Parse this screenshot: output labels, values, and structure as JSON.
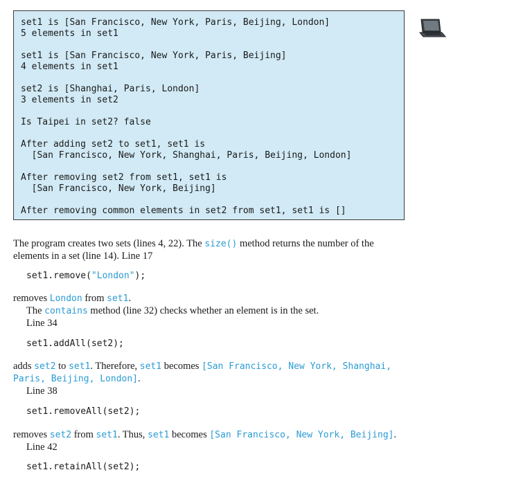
{
  "console": {
    "lines": [
      "set1 is [San Francisco, New York, Paris, Beijing, London]",
      "5 elements in set1",
      "set1 is [San Francisco, New York, Paris, Beijing]",
      "4 elements in set1",
      "set2 is [Shanghai, Paris, London]",
      "3 elements in set2",
      "Is Taipei in set2? false",
      "After adding set2 to set1, set1 is",
      "  [San Francisco, New York, Shanghai, Paris, Beijing, London]",
      "After removing set2 from set1, set1 is",
      "  [San Francisco, New York, Beijing]",
      "After removing common elements in set2 from set1, set1 is []"
    ]
  },
  "icons": {
    "laptop": "laptop-icon"
  },
  "colors": {
    "console_bg": "#d1eaf5",
    "code_blue": "#2a9bd4"
  },
  "text": {
    "p1_a": "The program creates two sets (lines 4, 22). The ",
    "p1_code": "size()",
    "p1_b": " method returns the number of the",
    "p1_line2": "elements in a set (line 14). Line 17",
    "code1_a": "set1.remove(",
    "code1_str": "\"London\"",
    "code1_b": ");",
    "p2_a": "removes ",
    "p2_c1": "London",
    "p2_b": " from ",
    "p2_c2": "set1",
    "p2_c": ".",
    "p3_a": "The ",
    "p3_code": "contains",
    "p3_b": " method (line 32) checks whether an element is in the set.",
    "p3_line2": "Line 34",
    "code2": "set1.addAll(set2);",
    "p4_a": "adds ",
    "p4_c1": "set2",
    "p4_b": " to ",
    "p4_c2": "set1",
    "p4_c": ". Therefore, ",
    "p4_c3": "set1",
    "p4_d": " becomes ",
    "p4_c4": "[San Francisco, New York, Shanghai,",
    "p4_line2_code": "Paris, Beijing, London]",
    "p4_line2_end": ".",
    "p5": "Line 38",
    "code3": "set1.removeAll(set2);",
    "p6_a": "removes ",
    "p6_c1": "set2",
    "p6_b": " from ",
    "p6_c2": "set1",
    "p6_c": ". Thus, ",
    "p6_c3": "set1",
    "p6_d": " becomes ",
    "p6_c4": "[San Francisco, New York, Beijing]",
    "p6_e": ".",
    "p7": "Line 42",
    "code4": "set1.retainAll(set2);"
  }
}
